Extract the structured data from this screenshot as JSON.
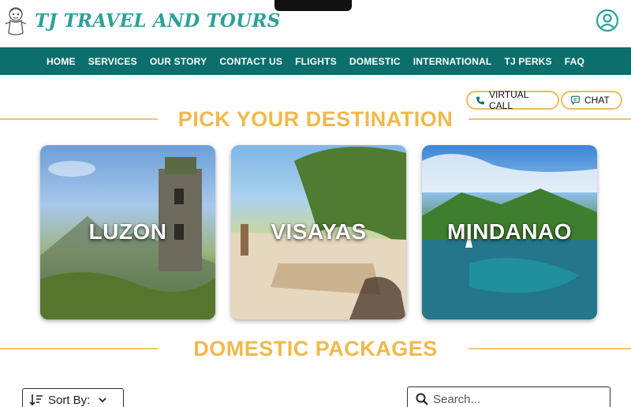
{
  "header": {
    "brand": "TJ TRAVEL AND TOURS",
    "logo_icon": "mascot-logo-icon",
    "account_icon": "user-circle-icon"
  },
  "nav": {
    "items": [
      "HOME",
      "SERVICES",
      "OUR STORY",
      "CONTACT US",
      "FLIGHTS",
      "DOMESTIC",
      "INTERNATIONAL",
      "TJ PERKS",
      "FAQ"
    ]
  },
  "contact": {
    "virtual_call": "VIRTUAL CALL",
    "virtual_call_icon": "phone-icon",
    "chat": "CHAT",
    "chat_icon": "chat-bubble-icon"
  },
  "destinations": {
    "title": "PICK YOUR DESTINATION",
    "cards": [
      {
        "label": "LUZON"
      },
      {
        "label": "VISAYAS"
      },
      {
        "label": "MINDANAO"
      }
    ]
  },
  "packages": {
    "title": "DOMESTIC PACKAGES",
    "sort_label": "Sort By:",
    "sort_icon": "sort-descending-icon",
    "search_placeholder": "Search...",
    "search_icon": "search-icon"
  },
  "colors": {
    "brand_teal": "#2aa198",
    "nav_bg": "#0d6f6c",
    "accent_gold": "#f2b84b"
  }
}
